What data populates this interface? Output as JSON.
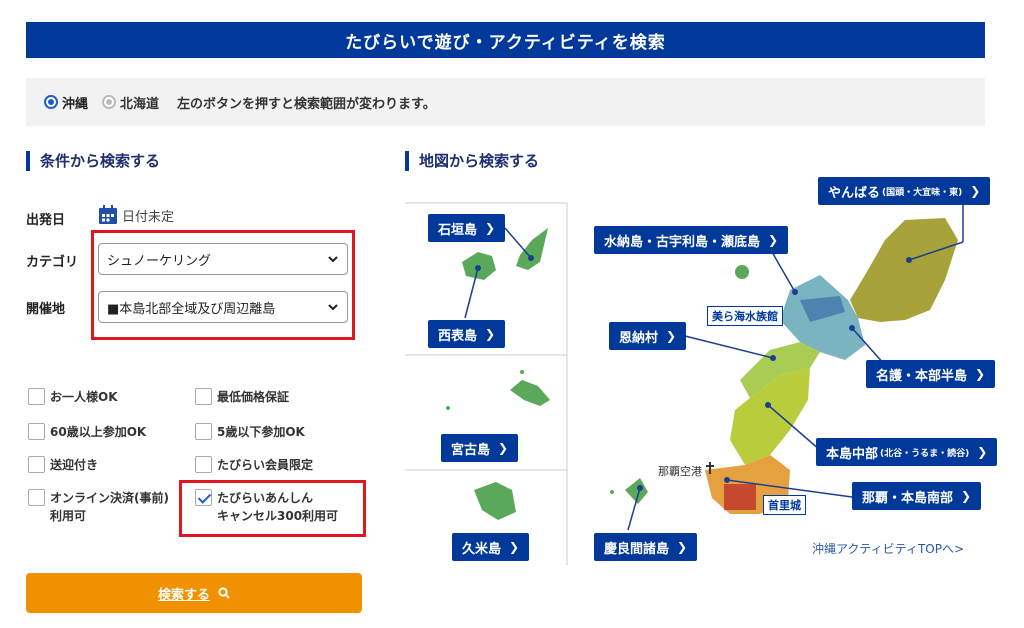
{
  "header": {
    "title": "たびらいで遊び・アクティビティを検索"
  },
  "region": {
    "options": [
      {
        "label": "沖縄",
        "selected": true
      },
      {
        "label": "北海道",
        "selected": false
      }
    ],
    "note": "左のボタンを押すと検索範囲が変わります。"
  },
  "conditions": {
    "title": "条件から検索する",
    "date_label": "出発日",
    "date_value": "日付未定",
    "category_label": "カテゴリ",
    "category_value": "シュノーケリング",
    "venue_label": "開催地",
    "venue_value": "■本島北部全域及び周辺離島",
    "checkboxes": [
      {
        "label": "お一人様OK",
        "checked": false
      },
      {
        "label": "最低価格保証",
        "checked": false
      },
      {
        "label": "60歳以上参加OK",
        "checked": false
      },
      {
        "label": "5歳以下参加OK",
        "checked": false
      },
      {
        "label": "送迎付き",
        "checked": false
      },
      {
        "label": "たびらい会員限定",
        "checked": false
      },
      {
        "label": "オンライン決済(事前)",
        "label2": "利用可",
        "checked": false
      },
      {
        "label": "たびらいあんしん",
        "label2": "キャンセル300利用可",
        "checked": true
      }
    ],
    "search_button": "検索する"
  },
  "map": {
    "title": "地図から検索する",
    "areas": {
      "ishigaki": "石垣島",
      "iriomote": "西表島",
      "miyako": "宮古島",
      "kume": "久米島",
      "kerama": "慶良間諸島",
      "minnajima": "水納島・古宇利島・瀬底島",
      "onna": "恩納村",
      "yanbaru": "やんばる",
      "yanbaru_sub": "(国頭・大宜味・東)",
      "nago": "名護・本部半島",
      "chubu": "本島中部",
      "chubu_sub": "(北谷・うるま・読谷)",
      "naha": "那覇・本島南部"
    },
    "aquarium": "美ら海水族館",
    "shuri": "首里城",
    "airport": "那覇空港",
    "top_link": "沖縄アクティビティTOPへ>"
  },
  "colors": {
    "primary": "#00399a",
    "accent": "#f29100",
    "highlight": "#e0171e"
  }
}
